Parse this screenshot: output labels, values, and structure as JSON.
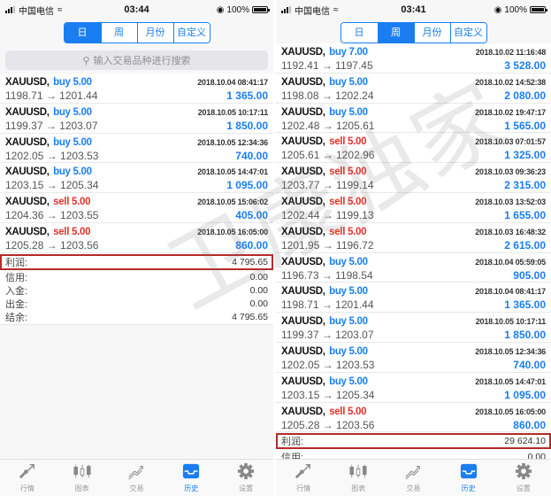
{
  "colors": {
    "accent": "#1a7ef2",
    "buy": "#1a7ef2",
    "sell": "#e0332b",
    "highlight_box": "#b52a2a"
  },
  "watermark": "卫康独家",
  "left": {
    "status": {
      "carrier": "中国电信",
      "time": "03:44",
      "battery": "100%"
    },
    "segments": [
      {
        "label": "日",
        "active": true
      },
      {
        "label": "周",
        "active": false
      },
      {
        "label": "月份",
        "active": false
      },
      {
        "label": "自定义",
        "active": false
      }
    ],
    "search_placeholder": "输入交易品种进行搜索",
    "trades": [
      {
        "symbol": "XAUUSD,",
        "side": "buy",
        "direction": "buy 5.00",
        "time": "2018.10.04 08:41:17",
        "prices": "1198.71 → 1201.44",
        "profit": "1 365.00"
      },
      {
        "symbol": "XAUUSD,",
        "side": "buy",
        "direction": "buy 5.00",
        "time": "2018.10.05 10:17:11",
        "prices": "1199.37 → 1203.07",
        "profit": "1 850.00"
      },
      {
        "symbol": "XAUUSD,",
        "side": "buy",
        "direction": "buy 5.00",
        "time": "2018.10.05 12:34:36",
        "prices": "1202.05 → 1203.53",
        "profit": "740.00"
      },
      {
        "symbol": "XAUUSD,",
        "side": "buy",
        "direction": "buy 5.00",
        "time": "2018.10.05 14:47:01",
        "prices": "1203.15 → 1205.34",
        "profit": "1 095.00"
      },
      {
        "symbol": "XAUUSD,",
        "side": "sell",
        "direction": "sell 5.00",
        "time": "2018.10.05 15:06:02",
        "prices": "1204.36 → 1203.55",
        "profit": "405.00"
      },
      {
        "symbol": "XAUUSD,",
        "side": "sell",
        "direction": "sell 5.00",
        "time": "2018.10.05 16:05:00",
        "prices": "1205.28 → 1203.56",
        "profit": "860.00"
      }
    ],
    "summary": [
      {
        "label": "利润:",
        "value": "4 795.65",
        "highlight": true
      },
      {
        "label": "信用:",
        "value": "0.00"
      },
      {
        "label": "入金:",
        "value": "0.00"
      },
      {
        "label": "出金:",
        "value": "0.00"
      },
      {
        "label": "结余:",
        "value": "4 795.65"
      }
    ]
  },
  "right": {
    "status": {
      "carrier": "中国电信",
      "time": "03:41",
      "battery": "100%"
    },
    "segments": [
      {
        "label": "日",
        "active": false
      },
      {
        "label": "周",
        "active": true
      },
      {
        "label": "月份",
        "active": false
      },
      {
        "label": "自定义",
        "active": false
      }
    ],
    "trades": [
      {
        "symbol": "XAUUSD,",
        "side": "buy",
        "direction": "buy 7.00",
        "time": "2018.10.02 11:16:48",
        "prices": "1192.41 → 1197.45",
        "profit": "3 528.00"
      },
      {
        "symbol": "XAUUSD,",
        "side": "buy",
        "direction": "buy 5.00",
        "time": "2018.10.02 14:52:38",
        "prices": "1198.08 → 1202.24",
        "profit": "2 080.00"
      },
      {
        "symbol": "XAUUSD,",
        "side": "buy",
        "direction": "buy 5.00",
        "time": "2018.10.02 19:47:17",
        "prices": "1202.48 → 1205.61",
        "profit": "1 565.00"
      },
      {
        "symbol": "XAUUSD,",
        "side": "sell",
        "direction": "sell 5.00",
        "time": "2018.10.03 07:01:57",
        "prices": "1205.61 → 1202.96",
        "profit": "1 325.00"
      },
      {
        "symbol": "XAUUSD,",
        "side": "sell",
        "direction": "sell 5.00",
        "time": "2018.10.03 09:36:23",
        "prices": "1203.77 → 1199.14",
        "profit": "2 315.00"
      },
      {
        "symbol": "XAUUSD,",
        "side": "sell",
        "direction": "sell 5.00",
        "time": "2018.10.03 13:52:03",
        "prices": "1202.44 → 1199.13",
        "profit": "1 655.00"
      },
      {
        "symbol": "XAUUSD,",
        "side": "sell",
        "direction": "sell 5.00",
        "time": "2018.10.03 16:48:32",
        "prices": "1201.95 → 1196.72",
        "profit": "2 615.00"
      },
      {
        "symbol": "XAUUSD,",
        "side": "buy",
        "direction": "buy 5.00",
        "time": "2018.10.04 05:59:05",
        "prices": "1196.73 → 1198.54",
        "profit": "905.00"
      },
      {
        "symbol": "XAUUSD,",
        "side": "buy",
        "direction": "buy 5.00",
        "time": "2018.10.04 08:41:17",
        "prices": "1198.71 → 1201.44",
        "profit": "1 365.00"
      },
      {
        "symbol": "XAUUSD,",
        "side": "buy",
        "direction": "buy 5.00",
        "time": "2018.10.05 10:17:11",
        "prices": "1199.37 → 1203.07",
        "profit": "1 850.00"
      },
      {
        "symbol": "XAUUSD,",
        "side": "buy",
        "direction": "buy 5.00",
        "time": "2018.10.05 12:34:36",
        "prices": "1202.05 → 1203.53",
        "profit": "740.00"
      },
      {
        "symbol": "XAUUSD,",
        "side": "buy",
        "direction": "buy 5.00",
        "time": "2018.10.05 14:47:01",
        "prices": "1203.15 → 1205.34",
        "profit": "1 095.00"
      },
      {
        "symbol": "XAUUSD,",
        "side": "sell",
        "direction": "sell 5.00",
        "time": "2018.10.05 16:05:00",
        "prices": "1205.28 → 1203.56",
        "profit": "860.00"
      }
    ],
    "summary": [
      {
        "label": "利润:",
        "value": "29 624.10",
        "highlight": true
      },
      {
        "label": "信用:",
        "value": "0.00"
      }
    ]
  },
  "tabbar": [
    {
      "label": "行情",
      "icon": "quotes-arrows-icon",
      "active": false
    },
    {
      "label": "图表",
      "icon": "candlestick-chart-icon",
      "active": false
    },
    {
      "label": "交易",
      "icon": "trade-trend-icon",
      "active": false
    },
    {
      "label": "历史",
      "icon": "history-inbox-icon",
      "active": true
    },
    {
      "label": "设置",
      "icon": "settings-gear-icon",
      "active": false
    }
  ]
}
